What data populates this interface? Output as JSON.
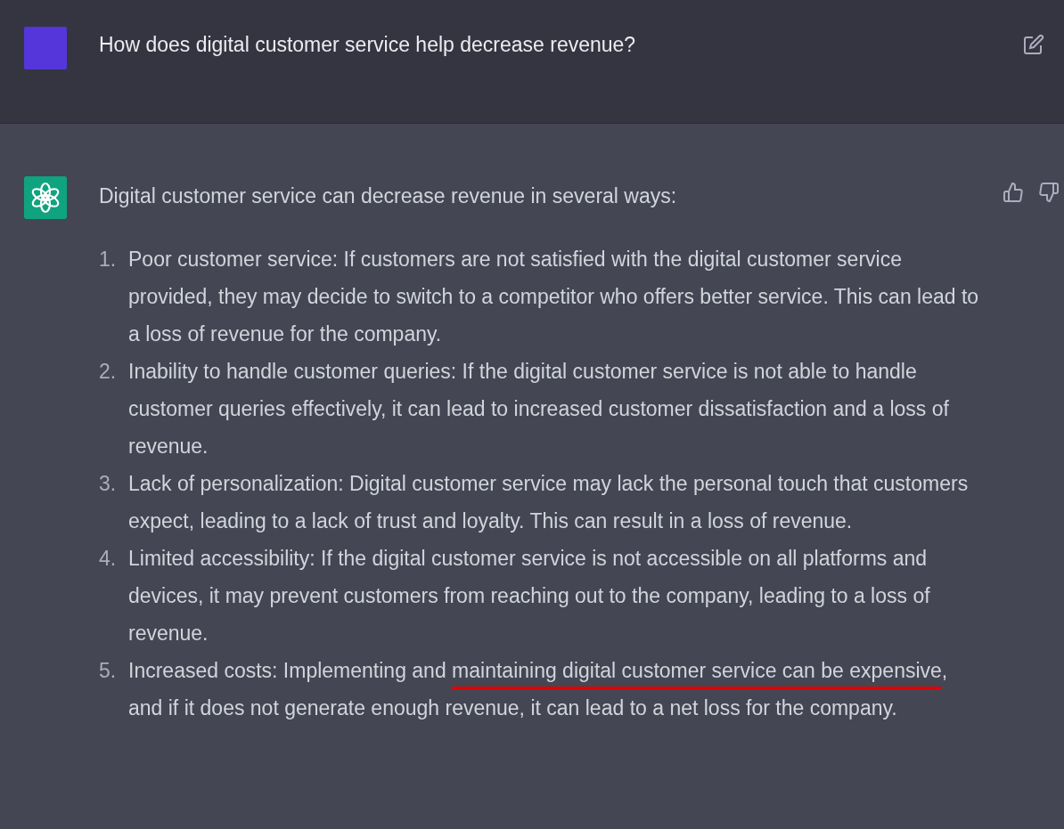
{
  "user_message": {
    "text": "How does digital customer service help decrease revenue?"
  },
  "assistant_message": {
    "intro": "Digital customer service can decrease revenue in several ways:",
    "items": [
      {
        "number": "1.",
        "segments": [
          {
            "text": "Poor customer service: If customers are not satisfied with the digital customer service provided, they may decide to switch to a competitor who offers better service. This can lead to a loss of revenue for the company.",
            "underlined": false
          }
        ]
      },
      {
        "number": "2.",
        "segments": [
          {
            "text": "Inability to handle customer queries: If the digital customer service is not able to handle customer queries effectively, it can lead to increased customer dissatisfaction and a loss of revenue.",
            "underlined": false
          }
        ]
      },
      {
        "number": "3.",
        "segments": [
          {
            "text": "Lack of personalization: Digital customer service may lack the personal touch that customers expect, leading to a lack of trust and loyalty. This can result in a loss of revenue.",
            "underlined": false
          }
        ]
      },
      {
        "number": "4.",
        "segments": [
          {
            "text": "Limited accessibility: If the digital customer service is not accessible on all platforms and devices, it may prevent customers from reaching out to the company, leading to a loss of revenue.",
            "underlined": false
          }
        ]
      },
      {
        "number": "5.",
        "segments": [
          {
            "text": "Increased costs: Implementing and ",
            "underlined": false
          },
          {
            "text": "maintaining digital customer service can be expensive",
            "underlined": true
          },
          {
            "text": ", and if it does not generate enough revenue, it can lead to a net loss for the company.",
            "underlined": false
          }
        ]
      }
    ]
  }
}
